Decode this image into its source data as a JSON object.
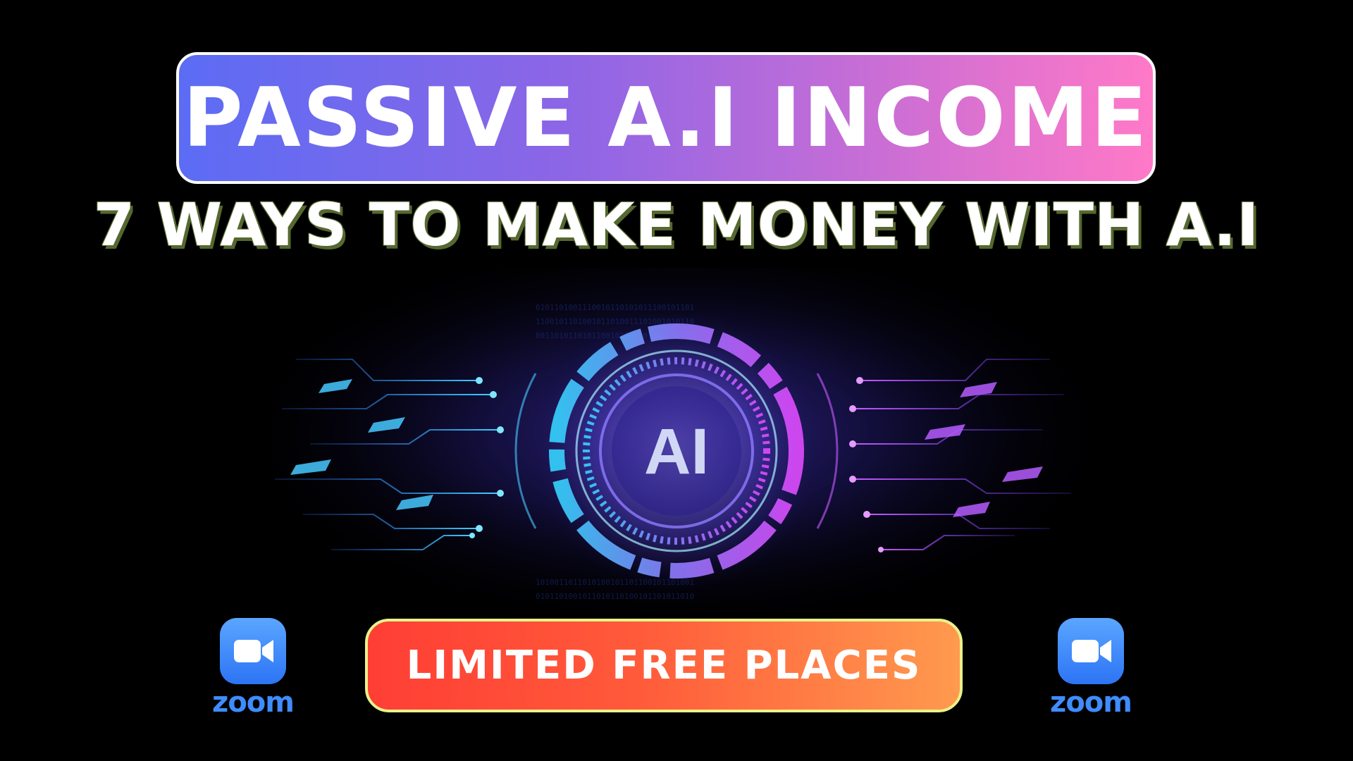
{
  "header": {
    "title": "PASSIVE A.I INCOME",
    "subtitle": "7 WAYS TO MAKE MONEY WITH A.I"
  },
  "hero": {
    "emblem_text": "AI"
  },
  "cta": {
    "label": "LIMITED FREE PLACES"
  },
  "zoom_left": {
    "icon": "video-camera-icon",
    "label": "zoom"
  },
  "zoom_right": {
    "icon": "video-camera-icon",
    "label": "zoom"
  },
  "colors": {
    "background": "#000000",
    "title_gradient_start": "#5b6cf4",
    "title_gradient_end": "#ff79c7",
    "subtitle_shadow": "#55682f",
    "cta_gradient_start": "#ff3e35",
    "cta_gradient_end": "#ff9a4e",
    "cta_border": "#e9f28a",
    "zoom_blue": "#2d74f5",
    "glow_cyan": "#35d4ff",
    "glow_magenta": "#e04bff"
  }
}
